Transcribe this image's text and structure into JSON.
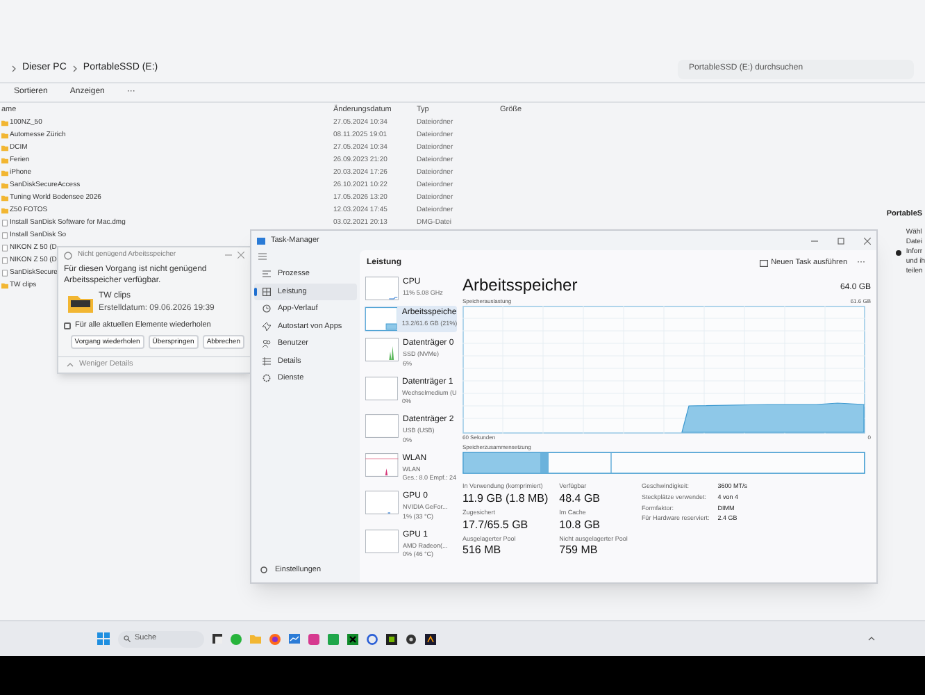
{
  "explorer": {
    "breadcrumb": [
      "Dieser PC",
      "PortableSSD (E:)"
    ],
    "search": {
      "placeholder": "PortableSSD (E:) durchsuchen"
    },
    "toolbar": [
      "Sortieren",
      "Anzeigen",
      "···"
    ],
    "columns": [
      "ame",
      "Änderungsdatum",
      "Typ",
      "Größe"
    ],
    "rows": [
      {
        "kind": "folder",
        "name": "100NZ_50",
        "date": "27.05.2024 10:34",
        "type": "Dateiordner"
      },
      {
        "kind": "folder",
        "name": "Automesse Zürich",
        "date": "08.11.2025 19:01",
        "type": "Dateiordner"
      },
      {
        "kind": "folder",
        "name": "DCIM",
        "date": "27.05.2024 10:34",
        "type": "Dateiordner"
      },
      {
        "kind": "folder",
        "name": "Ferien",
        "date": "26.09.2023 21:20",
        "type": "Dateiordner"
      },
      {
        "kind": "folder",
        "name": "iPhone",
        "date": "20.03.2024 17:26",
        "type": "Dateiordner"
      },
      {
        "kind": "folder",
        "name": "SanDiskSecureAccess",
        "date": "26.10.2021 10:22",
        "type": "Dateiordner"
      },
      {
        "kind": "folder",
        "name": "Tuning World Bodensee 2026",
        "date": "17.05.2026 13:20",
        "type": "Dateiordner"
      },
      {
        "kind": "folder",
        "name": "Z50 FOTOS",
        "date": "12.03.2024 17:45",
        "type": "Dateiordner"
      },
      {
        "kind": "file",
        "name": "Install SanDisk Software for Mac.dmg",
        "date": "03.02.2021 20:13",
        "type": "DMG-Datei"
      },
      {
        "kind": "file",
        "name": "Install SanDisk So"
      },
      {
        "kind": "file",
        "name": "NIKON Z 50 (D"
      },
      {
        "kind": "file",
        "name": "NIKON Z 50 (D"
      },
      {
        "kind": "file",
        "name": "SanDiskSecure"
      },
      {
        "kind": "folder",
        "name": "TW clips"
      }
    ],
    "details_pane": {
      "title": "PortableS",
      "lines": [
        "Wähl",
        "Datei",
        "Inforr",
        "und ih",
        "teilen"
      ]
    }
  },
  "dialog": {
    "title": "Nicht genügend Arbeitsspeicher",
    "message": "Für diesen Vorgang ist nicht genügend Arbeitsspeicher verfügbar.",
    "file": {
      "name": "TW clips",
      "created": "Erstelldatum: 09.06.2026 19:39"
    },
    "repeat": {
      "label": "Für alle aktuellen Elemente wiederholen",
      "checked": false
    },
    "buttons": [
      "Vorgang wiederholen",
      "Überspringen",
      "Abbrechen"
    ],
    "details_toggle": "Weniger Details"
  },
  "task_manager": {
    "title": "Task-Manager",
    "nav": [
      {
        "label": "Prozesse",
        "selected": false
      },
      {
        "label": "Leistung",
        "selected": true
      },
      {
        "label": "App-Verlauf",
        "selected": false
      },
      {
        "label": "Autostart von Apps",
        "selected": false
      },
      {
        "label": "Benutzer",
        "selected": false
      },
      {
        "label": "Details",
        "selected": false
      },
      {
        "label": "Dienste",
        "selected": false
      }
    ],
    "settings": "Einstellungen",
    "page_title": "Leistung",
    "run_task": "Neuen Task ausführen",
    "more": "···",
    "resources": [
      {
        "name": "CPU",
        "lines": [
          "11% 5.08 GHz"
        ],
        "selected": false
      },
      {
        "name": "Arbeitsspeiche",
        "lines": [
          "13.2/61.6 GB (21%)"
        ],
        "selected": true
      },
      {
        "name": "Datenträger 0",
        "lines": [
          "SSD (NVMe)",
          "6%"
        ],
        "selected": false
      },
      {
        "name": "Datenträger 1",
        "lines": [
          "Wechselmedium (U",
          "0%"
        ],
        "selected": false
      },
      {
        "name": "Datenträger 2",
        "lines": [
          "USB (USB)",
          "0%"
        ],
        "selected": false
      },
      {
        "name": "WLAN",
        "lines": [
          "WLAN",
          "Ges.: 8.0 Empf.: 24"
        ],
        "selected": false
      },
      {
        "name": "GPU 0",
        "lines": [
          "NVIDIA GeFor...",
          "1% (33 °C)"
        ],
        "selected": false
      },
      {
        "name": "GPU 1",
        "lines": [
          "AMD Radeon(...",
          "0% (46 °C)"
        ],
        "selected": false
      }
    ],
    "memory": {
      "title": "Arbeitsspeicher",
      "total": "64.0 GB",
      "usage_label": "Speicherauslastung",
      "usage_max": "61.6 GB",
      "time_span": "60 Sekunden",
      "time_end": "0",
      "composition_label": "Speicherzusammensetzung",
      "stats": [
        {
          "label": "In Verwendung (komprimiert)",
          "value": "11.9 GB (1.8 MB)"
        },
        {
          "label": "Verfügbar",
          "value": "48.4 GB"
        },
        {
          "label": "Zugesichert",
          "value": "17.7/65.5 GB"
        },
        {
          "label": "Im Cache",
          "value": "10.8 GB"
        },
        {
          "label": "Ausgelagerter Pool",
          "value": "516 MB"
        },
        {
          "label": "Nicht ausgelagerter Pool",
          "value": "759 MB"
        }
      ],
      "specs": [
        {
          "label": "Geschwindigkeit:",
          "value": "3600 MT/s"
        },
        {
          "label": "Steckplätze verwendet:",
          "value": "4 von 4"
        },
        {
          "label": "Formfaktor:",
          "value": "DIMM"
        },
        {
          "label": "Für Hardware reserviert:",
          "value": "2.4 GB"
        }
      ]
    }
  },
  "taskbar": {
    "search": {
      "placeholder": "Suche"
    }
  }
}
